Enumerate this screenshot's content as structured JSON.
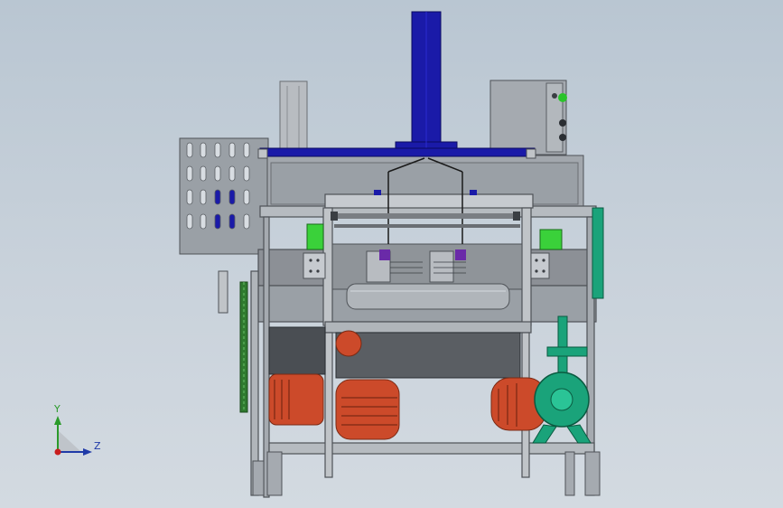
{
  "triad": {
    "y_label": "Y",
    "z_label": "Z"
  },
  "colors": {
    "background_top": "#b9c6d2",
    "background_bottom": "#d3dae1",
    "frame_steel": "#8c9096",
    "frame_dark": "#5a5e63",
    "column_blue": "#1a1aa8",
    "motor_orange": "#cc4a2a",
    "pump_green": "#1aa37a",
    "chain_green": "#2f7a2f",
    "accent_purple": "#6a2aa8",
    "light_green": "#3ad13a"
  }
}
